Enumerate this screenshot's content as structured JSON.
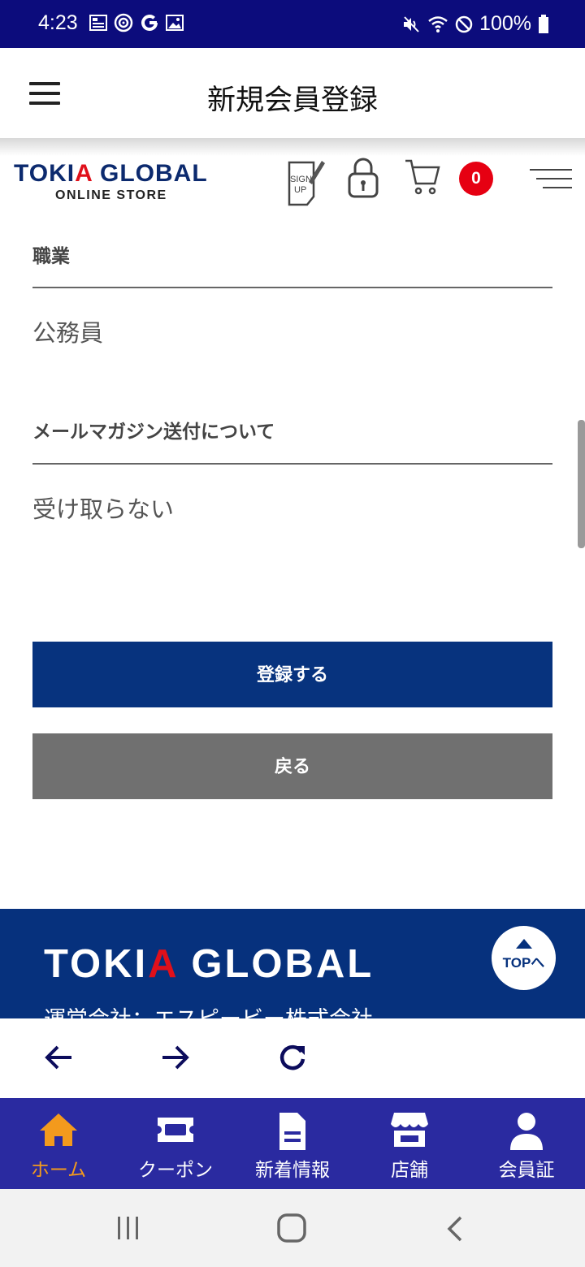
{
  "status_bar": {
    "time": "4:23",
    "battery_text": "100%",
    "left_icons": [
      "news-icon",
      "location-icon",
      "google-icon",
      "gallery-icon"
    ],
    "right_icons": [
      "mute-icon",
      "wifi-icon",
      "block-icon",
      "battery-icon"
    ]
  },
  "app_header": {
    "title": "新規会員登録"
  },
  "store_header": {
    "brand_prefix": "TOKI",
    "brand_accent": "A",
    "brand_suffix": " GLOBAL",
    "brand_sub": "ONLINE STORE",
    "signup_icon_text_1": "SIGN",
    "signup_icon_text_2": "UP",
    "cart_count": "0"
  },
  "form": {
    "occupation_label": "職業",
    "occupation_value": "公務員",
    "newsletter_label": "メールマガジン送付について",
    "newsletter_value": "受け取らない",
    "submit_label": "登録する",
    "back_label": "戻る"
  },
  "footer": {
    "brand_prefix": "TOKI",
    "brand_accent": "A",
    "brand_suffix": " GLOBAL",
    "company": "運営会社：エスピービー株式会社",
    "top_label": "TOPへ"
  },
  "tabs": [
    {
      "label": "ホーム",
      "icon": "home-icon",
      "active": true
    },
    {
      "label": "クーポン",
      "icon": "coupon-icon",
      "active": false
    },
    {
      "label": "新着情報",
      "icon": "document-icon",
      "active": false
    },
    {
      "label": "店舗",
      "icon": "store-icon",
      "active": false
    },
    {
      "label": "会員証",
      "icon": "person-icon",
      "active": false
    }
  ],
  "colors": {
    "status_bar": "#0c0c7c",
    "brand_navy": "#07337e",
    "accent_red": "#e60012",
    "tab_bar": "#2a2aa0",
    "tab_active": "#f39a1d",
    "secondary_button": "#707070"
  }
}
